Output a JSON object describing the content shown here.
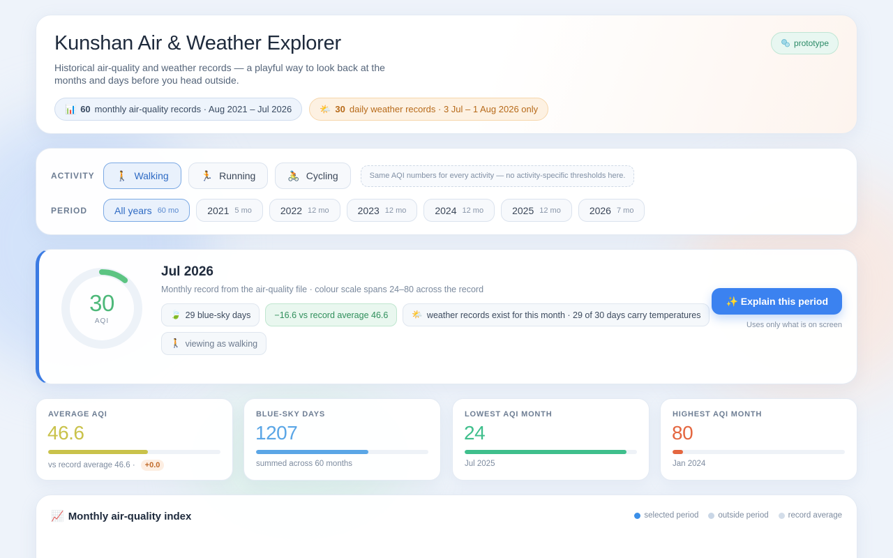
{
  "header": {
    "title": "Kunshan Air & Weather Explorer",
    "subtitle": "Historical air-quality and weather records — a playful way to look back at the months and days before you head outside.",
    "badge": "prototype",
    "badge_icon": "bubbles-icon",
    "chips": [
      {
        "icon": "📊",
        "count": "60",
        "text": "monthly air-quality records · Aug 2021 – Jul 2026"
      },
      {
        "icon": "🌤️",
        "count": "30",
        "text": "daily weather records · 3 Jul – 1 Aug 2026 only"
      }
    ]
  },
  "controls": {
    "activity_label": "ACTIVITY",
    "period_label": "PERIOD",
    "activities": [
      {
        "icon": "🚶",
        "label": "Walking",
        "active": true
      },
      {
        "icon": "🏃",
        "label": "Running",
        "active": false
      },
      {
        "icon": "🚴",
        "label": "Cycling",
        "active": false
      }
    ],
    "activity_note": "Same AQI numbers for every activity — no activity-specific thresholds here.",
    "periods": [
      {
        "label": "All years",
        "count": "60 mo",
        "active": true
      },
      {
        "label": "2021",
        "count": "5 mo",
        "active": false
      },
      {
        "label": "2022",
        "count": "12 mo",
        "active": false
      },
      {
        "label": "2023",
        "count": "12 mo",
        "active": false
      },
      {
        "label": "2024",
        "count": "12 mo",
        "active": false
      },
      {
        "label": "2025",
        "count": "12 mo",
        "active": false
      },
      {
        "label": "2026",
        "count": "7 mo",
        "active": false
      }
    ]
  },
  "focus": {
    "aqi_value": "30",
    "aqi_unit": "AQI",
    "gauge_fraction": 0.11,
    "gauge_color": "#5cc482",
    "title": "Jul 2026",
    "subtitle": "Monthly record from the air-quality file · colour scale spans 24–80 across the record",
    "pills": [
      {
        "icon": "🍃",
        "text": "29 blue-sky days",
        "style": "plain"
      },
      {
        "icon": "",
        "text": "−16.6 vs record average 46.6",
        "style": "green"
      },
      {
        "icon": "🌤️",
        "text": "weather records exist for this month · 29 of 30 days carry temperatures",
        "style": "plain"
      },
      {
        "icon": "🚶",
        "text": "viewing as walking",
        "style": "muted"
      }
    ],
    "explain_button": "✨ Explain this period",
    "explain_note": "Uses only what is on screen"
  },
  "stats": [
    {
      "label": "AVERAGE AQI",
      "value": "46.6",
      "color": "#c9c24a",
      "fill": 0.58,
      "note": "vs record average 46.6 ·",
      "delta": "+0.0"
    },
    {
      "label": "BLUE-SKY DAYS",
      "value": "1207",
      "color": "#5aa6e6",
      "fill": 0.65,
      "note": "summed across 60 months",
      "delta": ""
    },
    {
      "label": "LOWEST AQI MONTH",
      "value": "24",
      "color": "#3fbf8c",
      "fill": 0.94,
      "note": "Jul 2025",
      "delta": ""
    },
    {
      "label": "HIGHEST AQI MONTH",
      "value": "80",
      "color": "#e4663f",
      "fill": 0.06,
      "note": "Jan 2024",
      "delta": ""
    }
  ],
  "chart": {
    "icon": "📈",
    "title": "Monthly air-quality index",
    "legend": [
      {
        "label": "selected period",
        "color": "#3b8fe8"
      },
      {
        "label": "outside period",
        "color": "#c9d6e6"
      },
      {
        "label": "record average",
        "color": "#d3dde9"
      }
    ]
  }
}
